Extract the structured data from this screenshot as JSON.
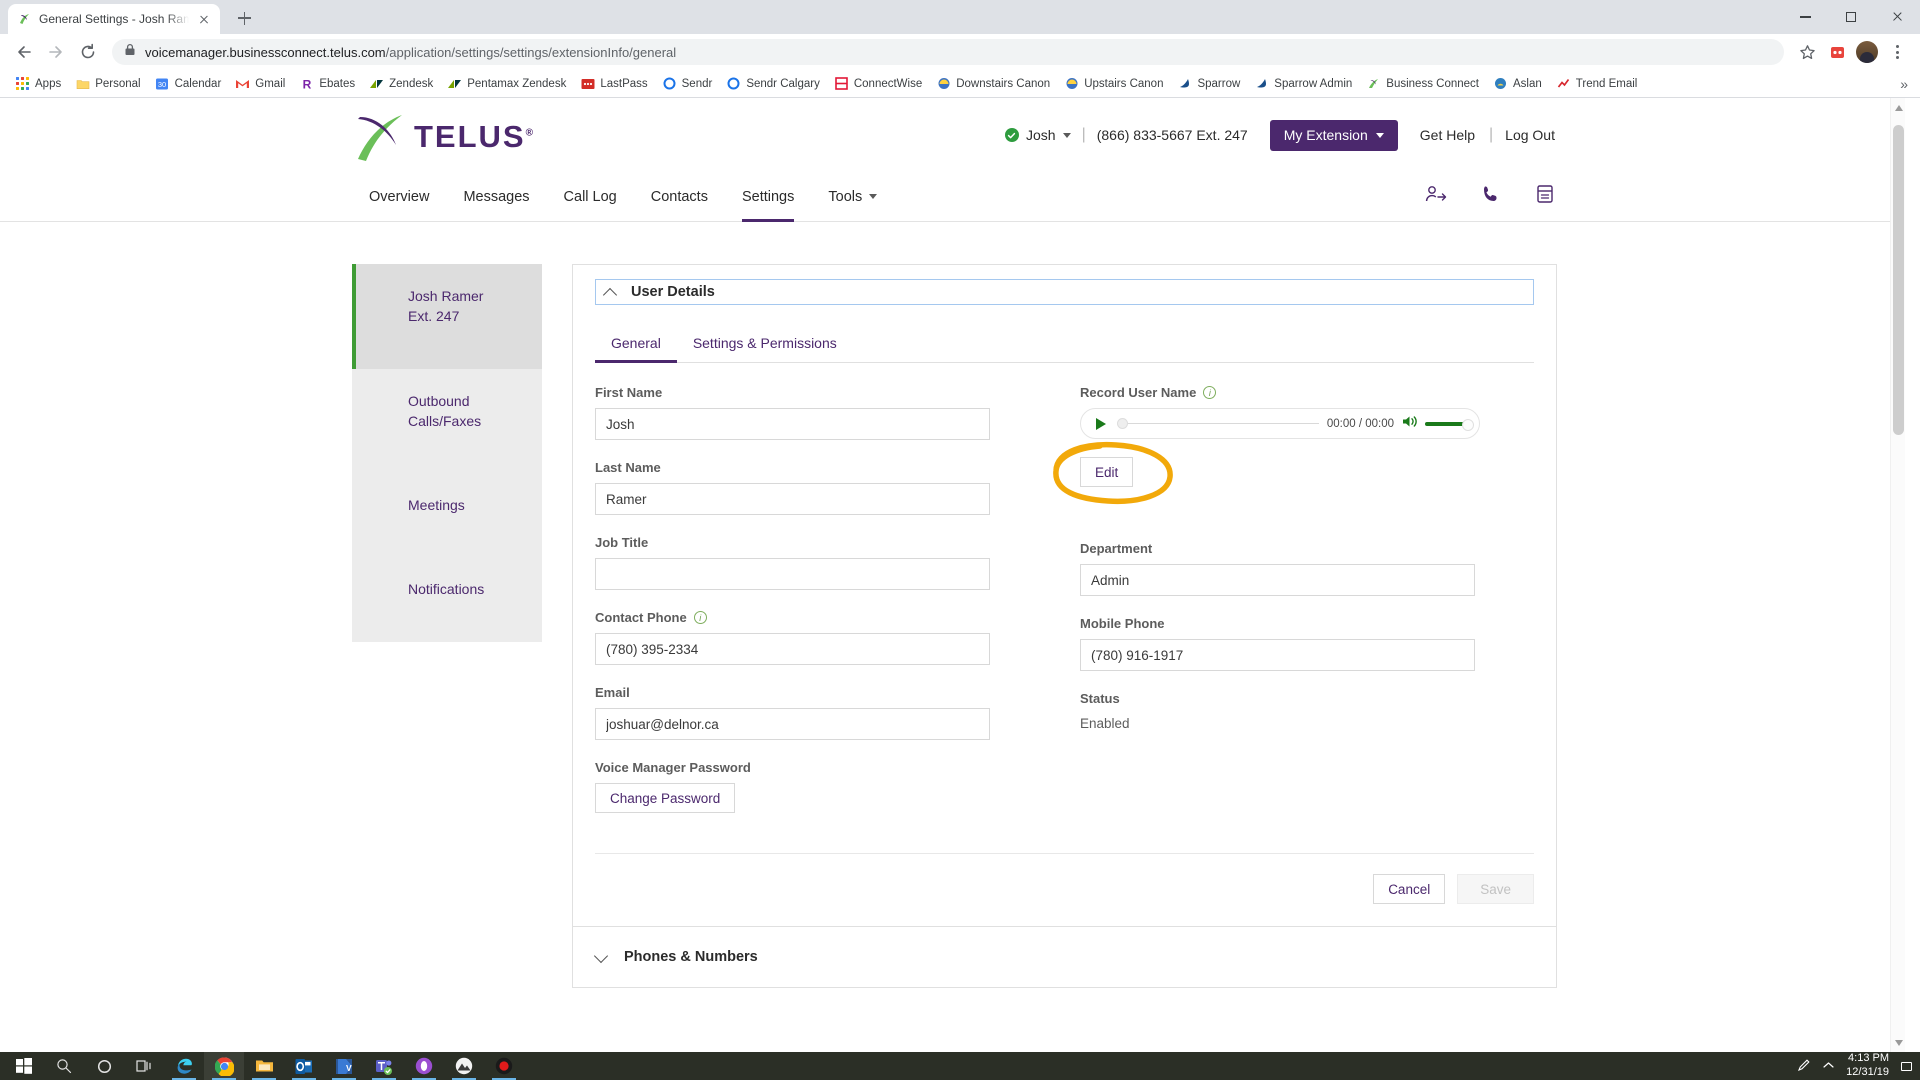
{
  "browser": {
    "tab": {
      "title": "General Settings - Josh Ramer - j",
      "favicon": "telus-icon"
    },
    "new_tab_label": "+",
    "url_bold": "voicemanager.businessconnect.telus.com",
    "url_dim": "/application/settings/settings/extensionInfo/general",
    "lock_icon": "lock-icon",
    "back_icon": "back-arrow-icon",
    "forward_icon": "forward-arrow-icon",
    "reload_icon": "reload-icon",
    "star_icon": "bookmark-star-icon",
    "extension_icon": "extension-icon",
    "profile_icon": "profile-avatar-icon",
    "menu_icon": "three-dot-menu-icon",
    "window_controls": [
      "minimize",
      "maximize",
      "close"
    ],
    "bookmarks": [
      {
        "label": "Apps",
        "icon": "apps-grid-icon"
      },
      {
        "label": "Personal",
        "icon": "folder-icon"
      },
      {
        "label": "Calendar",
        "icon": "calendar-30-icon"
      },
      {
        "label": "Gmail",
        "icon": "gmail-m-icon"
      },
      {
        "label": "Ebates",
        "icon": "ebates-r-icon"
      },
      {
        "label": "Zendesk",
        "icon": "zendesk-icon"
      },
      {
        "label": "Pentamax Zendesk",
        "icon": "zendesk-icon"
      },
      {
        "label": "LastPass",
        "icon": "lastpass-icon"
      },
      {
        "label": "Sendr",
        "icon": "circle-blue-icon"
      },
      {
        "label": "Sendr Calgary",
        "icon": "circle-blue-icon"
      },
      {
        "label": "ConnectWise",
        "icon": "connectwise-icon"
      },
      {
        "label": "Downstairs Canon",
        "icon": "printer-icon"
      },
      {
        "label": "Upstairs Canon",
        "icon": "printer-icon"
      },
      {
        "label": "Sparrow",
        "icon": "sparrow-bird-icon"
      },
      {
        "label": "Sparrow Admin",
        "icon": "sparrow-bird-icon"
      },
      {
        "label": "Business Connect",
        "icon": "telus-icon"
      },
      {
        "label": "Aslan",
        "icon": "aslan-icon"
      },
      {
        "label": "Trend Email",
        "icon": "trend-icon"
      }
    ],
    "bookmarks_overflow": "»"
  },
  "app_header": {
    "brand": "TELUS",
    "brand_mark": "®",
    "user_name": "Josh",
    "status_icon": "green-check-status-icon",
    "separator": "|",
    "phone": "(866) 833-5667 Ext. 247",
    "extension_button": "My Extension",
    "get_help": "Get Help",
    "log_out": "Log Out",
    "nav": [
      {
        "label": "Overview",
        "active": false
      },
      {
        "label": "Messages",
        "active": false
      },
      {
        "label": "Call Log",
        "active": false
      },
      {
        "label": "Contacts",
        "active": false
      },
      {
        "label": "Settings",
        "active": true
      },
      {
        "label": "Tools",
        "active": false,
        "has_caret": true
      }
    ],
    "nav_icons": [
      "contacts-transfer-icon",
      "phone-handset-icon",
      "fax-machine-icon"
    ]
  },
  "sidebar": {
    "items": [
      {
        "label_line1": "Josh Ramer",
        "label_line2": "Ext. 247",
        "active": true
      },
      {
        "label_line1": "Outbound",
        "label_line2": "Calls/Faxes",
        "active": false
      },
      {
        "label_line1": "Meetings",
        "label_line2": "",
        "active": false
      },
      {
        "label_line1": "Notifications",
        "label_line2": "",
        "active": false
      }
    ]
  },
  "panel": {
    "title": "User Details",
    "collapse_icon": "chevron-up-icon",
    "tabs": [
      {
        "label": "General",
        "active": true
      },
      {
        "label": "Settings & Permissions",
        "active": false
      }
    ],
    "fields": {
      "first_name": {
        "label": "First Name",
        "value": "Josh"
      },
      "last_name": {
        "label": "Last Name",
        "value": "Ramer"
      },
      "job_title": {
        "label": "Job Title",
        "value": ""
      },
      "contact_phone": {
        "label": "Contact Phone",
        "value": "(780) 395-2334",
        "info_icon": "info-icon"
      },
      "email": {
        "label": "Email",
        "value": "joshuar@delnor.ca"
      },
      "voice_manager_password": {
        "label": "Voice Manager Password",
        "button": "Change Password"
      },
      "record_user_name": {
        "label": "Record User Name",
        "info_icon": "info-icon"
      },
      "department": {
        "label": "Department",
        "value": "Admin"
      },
      "mobile_phone": {
        "label": "Mobile Phone",
        "value": "(780) 916-1917"
      },
      "status": {
        "label": "Status",
        "value": "Enabled"
      }
    },
    "player": {
      "play_icon": "play-triangle-icon",
      "time": "00:00 / 00:00",
      "volume_icon": "speaker-volume-icon"
    },
    "edit_button": "Edit",
    "annotation": {
      "shape": "hand-drawn-ellipse",
      "color": "#F2A90A",
      "target": "edit-button"
    },
    "cancel_button": "Cancel",
    "save_button": "Save"
  },
  "next_section": {
    "title": "Phones & Numbers",
    "expand_icon": "chevron-down-icon"
  },
  "taskbar": {
    "items": [
      {
        "name": "start-button",
        "icon": "windows-logo-icon"
      },
      {
        "name": "search-button",
        "icon": "magnifier-icon"
      },
      {
        "name": "cortana-button",
        "icon": "cortana-circle-icon"
      },
      {
        "name": "task-view-button",
        "icon": "task-view-icon"
      },
      {
        "name": "edge-button",
        "icon": "edge-browser-icon"
      },
      {
        "name": "chrome-button",
        "icon": "chrome-browser-icon"
      },
      {
        "name": "file-explorer-button",
        "icon": "folder-explorer-icon"
      },
      {
        "name": "outlook-button",
        "icon": "outlook-icon"
      },
      {
        "name": "visio-button",
        "icon": "visio-icon"
      },
      {
        "name": "teams-button",
        "icon": "microsoft-teams-icon"
      },
      {
        "name": "app-purple-button",
        "icon": "purple-circle-icon"
      },
      {
        "name": "photos-button",
        "icon": "photos-icon"
      },
      {
        "name": "record-button",
        "icon": "record-red-dot-icon"
      }
    ],
    "pen_icon": "pen-icon",
    "notification_icon": "notification-icon",
    "time": "4:13 PM",
    "date": "12/31/19"
  },
  "colors": {
    "telus_purple": "#4b286d",
    "telus_green": "#3f9c35",
    "annotation_orange": "#F2A90A",
    "accent_blue": "#a5c8ef"
  }
}
